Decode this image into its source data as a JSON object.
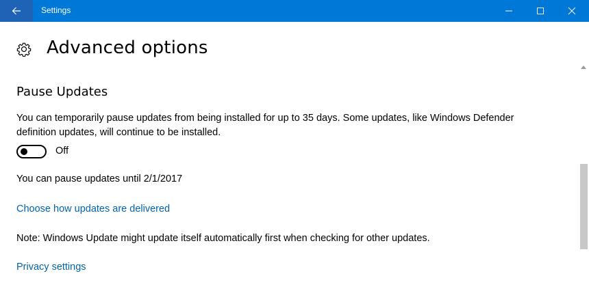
{
  "window": {
    "title": "Settings",
    "accent_color": "#0078d7",
    "back_icon": "arrow-left-icon",
    "controls": [
      "minimize-icon",
      "maximize-icon",
      "close-icon"
    ]
  },
  "header": {
    "icon": "gear-icon",
    "title": "Advanced options"
  },
  "pause_updates": {
    "heading": "Pause Updates",
    "description": "You can temporarily pause updates from being installed for up to 35 days. Some updates, like Windows Defender definition updates, will continue to be installed.",
    "toggle_state": "Off",
    "pause_until": "You can pause updates until 2/1/2017"
  },
  "links": {
    "delivery": "Choose how updates are delivered",
    "privacy": "Privacy settings",
    "link_color": "#0063b1"
  },
  "note": "Note: Windows Update might update itself automatically first when checking for other updates."
}
